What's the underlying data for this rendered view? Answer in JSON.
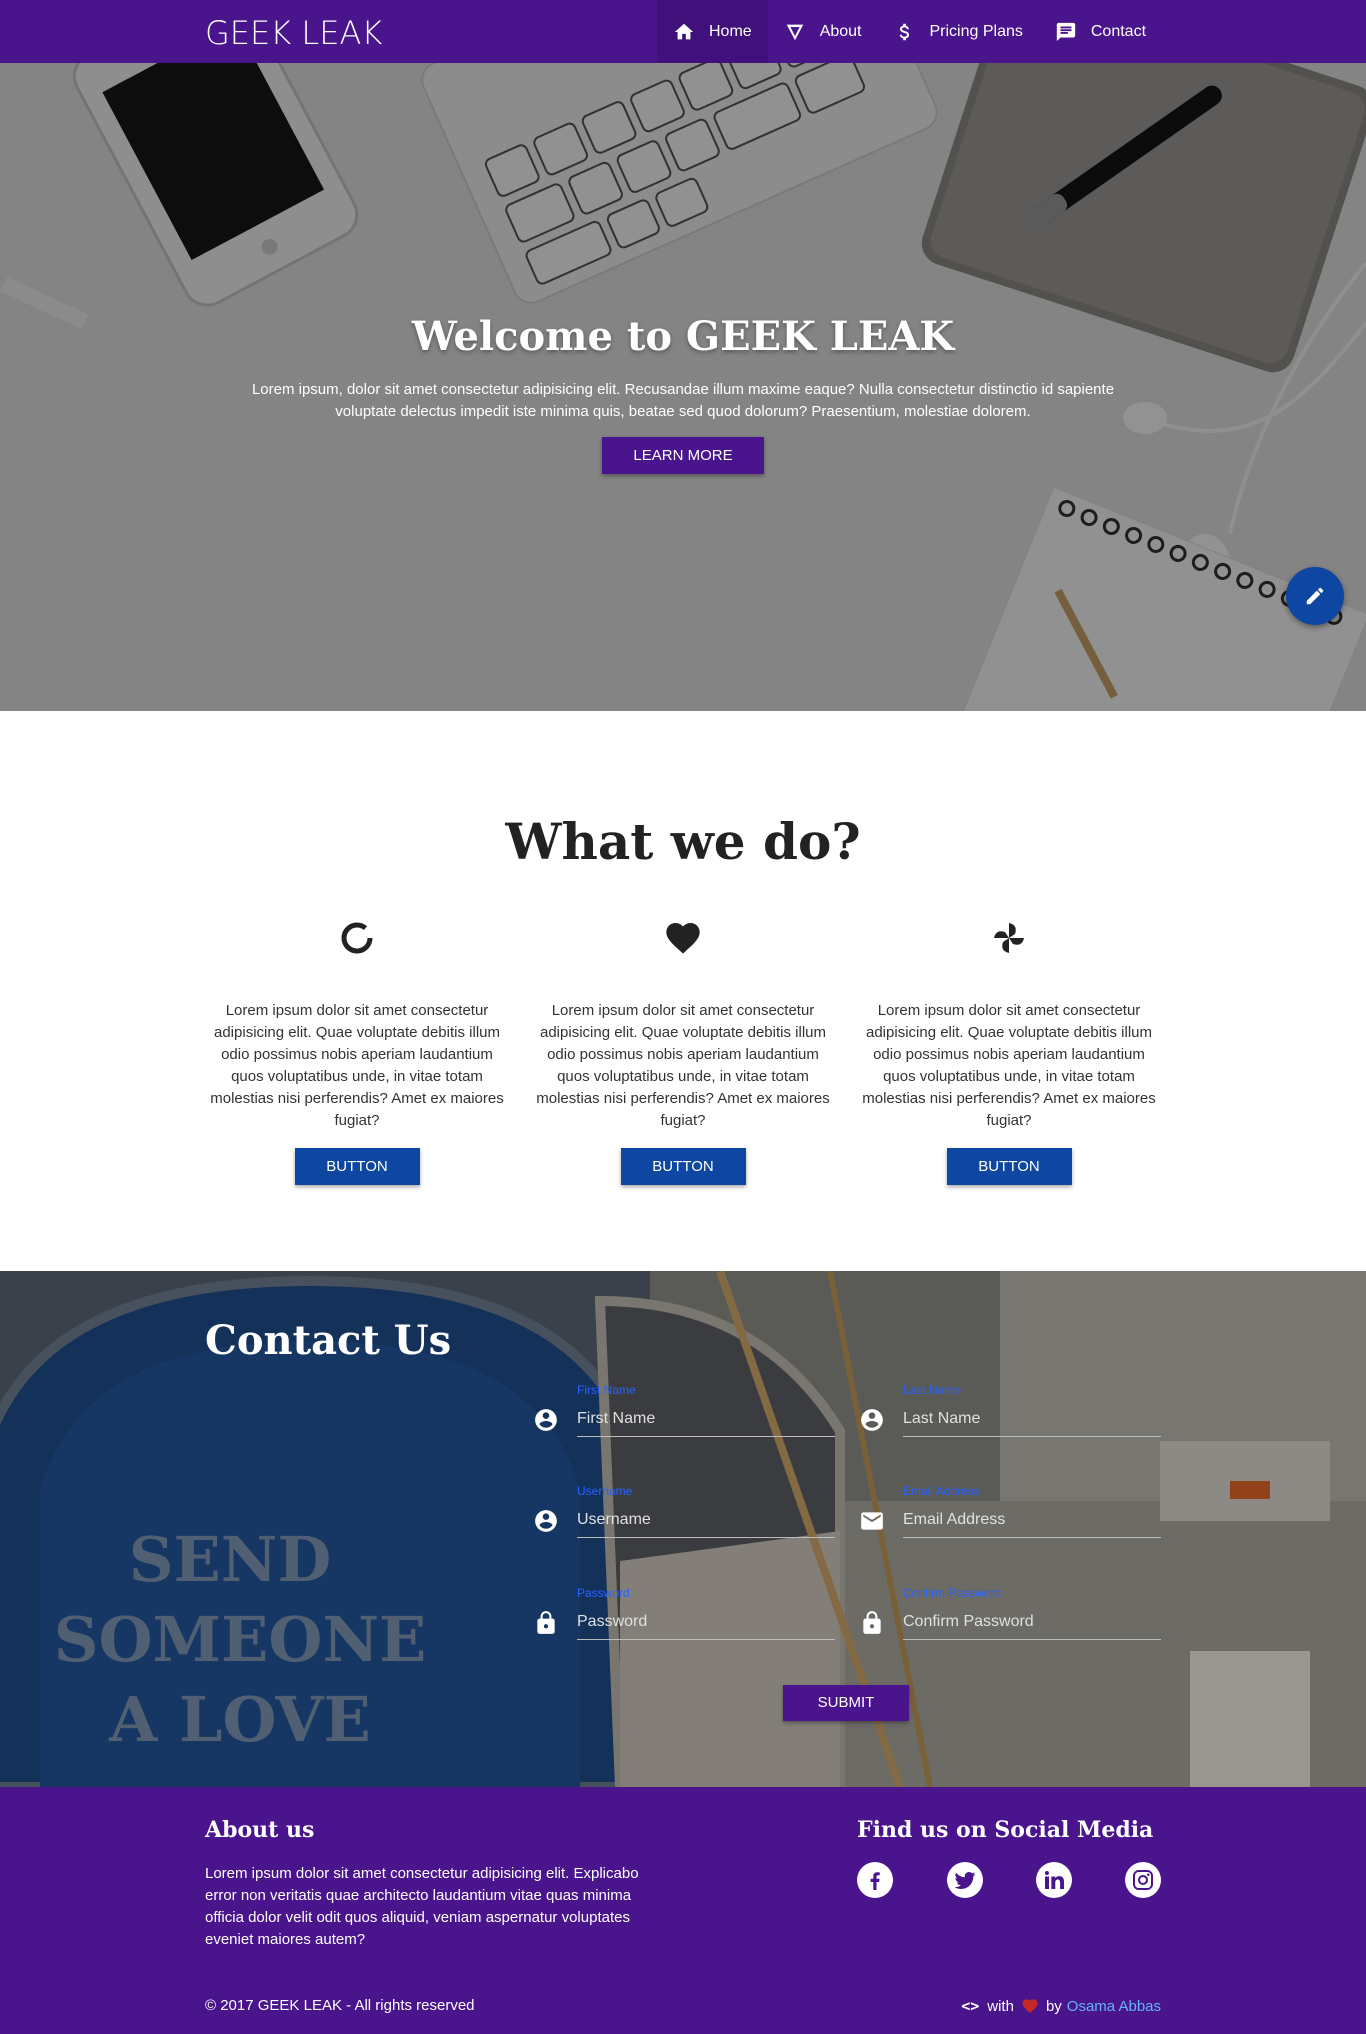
{
  "navbar": {
    "brand": "GEEK LEAK",
    "items": [
      {
        "label": "Home",
        "icon": "home-icon",
        "active": true
      },
      {
        "label": "About",
        "icon": "triangle-icon",
        "active": false
      },
      {
        "label": "Pricing Plans",
        "icon": "dollar-icon",
        "active": false
      },
      {
        "label": "Contact",
        "icon": "chat-icon",
        "active": false
      }
    ]
  },
  "hero": {
    "title": "Welcome to GEEK LEAK",
    "text": "Lorem ipsum, dolor sit amet consectetur adipisicing elit. Recusandae illum maxime eaque? Nulla consectetur distinctio id sapiente voluptate delectus impedit iste minima quis, beatae sed quod dolorum? Praesentium, molestiae dolorem.",
    "button": "LEARN MORE",
    "fab_icon": "pencil-icon"
  },
  "what_we_do": {
    "title": "What we do?",
    "features": [
      {
        "icon": "spinner-icon",
        "text": "Lorem ipsum dolor sit amet consectetur adipisicing elit. Quae voluptate debitis illum odio possimus nobis aperiam laudantium quos voluptatibus unde, in vitae totam molestias nisi perferendis? Amet ex maiores fugiat?",
        "button": "BUTTON"
      },
      {
        "icon": "heart-icon",
        "text": "Lorem ipsum dolor sit amet consectetur adipisicing elit. Quae voluptate debitis illum odio possimus nobis aperiam laudantium quos voluptatibus unde, in vitae totam molestias nisi perferendis? Amet ex maiores fugiat?",
        "button": "BUTTON"
      },
      {
        "icon": "pinwheel-icon",
        "text": "Lorem ipsum dolor sit amet consectetur adipisicing elit. Quae voluptate debitis illum odio possimus nobis aperiam laudantium quos voluptatibus unde, in vitae totam molestias nisi perferendis? Amet ex maiores fugiat?",
        "button": "BUTTON"
      }
    ]
  },
  "contact": {
    "title": "Contact Us",
    "fields": {
      "first_name": {
        "label": "First Name",
        "placeholder": "First Name",
        "icon": "account-circle-icon"
      },
      "last_name": {
        "label": "Last Name",
        "placeholder": "Last Name",
        "icon": "account-circle-icon"
      },
      "username": {
        "label": "Username",
        "placeholder": "Username",
        "icon": "account-circle-icon"
      },
      "email": {
        "label": "Email Address",
        "placeholder": "Email Address",
        "icon": "mail-icon"
      },
      "password": {
        "label": "Password",
        "placeholder": "Password",
        "icon": "lock-icon"
      },
      "confirm_password": {
        "label": "Confirm Password",
        "placeholder": "Confirm Password",
        "icon": "lock-icon"
      }
    },
    "submit": "SUBMIT"
  },
  "footer": {
    "about_title": "About us",
    "about_text": "Lorem ipsum dolor sit amet consectetur adipisicing elit. Explicabo error non veritatis quae architecto laudantium vitae quas minima officia dolor velit odit quos aliquid, veniam aspernatur voluptates eveniet maiores autem?",
    "social_title": "Find us on Social Media",
    "social": [
      "facebook-icon",
      "twitter-icon",
      "linkedin-icon",
      "instagram-icon"
    ],
    "copyright": "© 2017 GEEK LEAK - All rights reserved",
    "credit": {
      "code": "<>",
      "with": "with",
      "by": "by",
      "author": "Osama Abbas"
    }
  },
  "colors": {
    "primary": "#4a148c",
    "accent": "#0d47a1",
    "link": "#64b5f6",
    "heart": "#c62828"
  }
}
